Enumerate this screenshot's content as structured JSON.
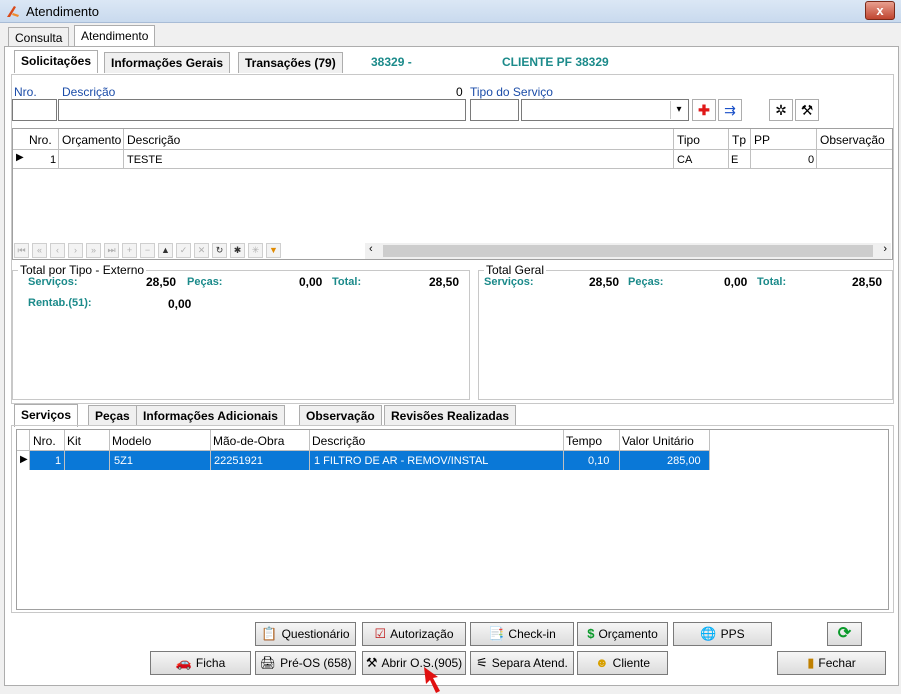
{
  "window": {
    "title": "Atendimento",
    "close_glyph": "x"
  },
  "outer_tabs": [
    {
      "label": "Consulta"
    },
    {
      "label": "Atendimento"
    }
  ],
  "inner_tabs": [
    {
      "label": "Solicitações"
    },
    {
      "label": "Informações Gerais"
    },
    {
      "label": "Transações (79)"
    }
  ],
  "header_info": {
    "code": "38329 -",
    "client": "CLIENTE PF 38329"
  },
  "form": {
    "nro_label": "Nro.",
    "descricao_label": "Descrição",
    "descricao_count": "0",
    "tipo_servico_label": "Tipo do Serviço"
  },
  "solicitacoes_grid": {
    "columns": [
      "Nro.",
      "Orçamento",
      "Descrição",
      "Tipo",
      "Tp",
      "PP",
      "Observação"
    ],
    "rows": [
      {
        "nro": "1",
        "orcamento": "",
        "descricao": "TESTE",
        "tipo": "CA",
        "tp": "E",
        "pp": "0",
        "observacao": ""
      }
    ]
  },
  "totals_externo": {
    "legend": "Total por Tipo - Externo",
    "servicos_label": "Serviços:",
    "servicos_value": "28,50",
    "pecas_label": "Peças:",
    "pecas_value": "0,00",
    "total_label": "Total:",
    "total_value": "28,50",
    "rentab_label": "Rentab.(51):",
    "rentab_value": "0,00"
  },
  "totals_geral": {
    "legend": "Total Geral",
    "servicos_label": "Serviços:",
    "servicos_value": "28,50",
    "pecas_label": "Peças:",
    "pecas_value": "0,00",
    "total_label": "Total:",
    "total_value": "28,50"
  },
  "detail_tabs": [
    {
      "label": "Serviços"
    },
    {
      "label": "Peças"
    },
    {
      "label": "Informações Adicionais"
    },
    {
      "label": "Observação"
    },
    {
      "label": "Revisões Realizadas"
    }
  ],
  "servicos_grid": {
    "columns": [
      "Nro.",
      "Kit",
      "Modelo",
      "Mão-de-Obra",
      "Descrição",
      "Tempo",
      "Valor Unitário"
    ],
    "rows": [
      {
        "nro": "1",
        "kit": "",
        "modelo": "5Z1",
        "mao_de_obra": "22251921",
        "descricao": "1 FILTRO DE AR - REMOV/INSTAL",
        "tempo": "0,10",
        "valor": "285,00"
      }
    ]
  },
  "buttons": {
    "questionario": "Questionário",
    "autorizacao": "Autorização",
    "checkin": "Check-in",
    "orcamento": "Orçamento",
    "pps": "PPS",
    "ficha": "Ficha",
    "pre_os": "Pré-OS (658)",
    "abrir_os": "Abrir O.S.(905)",
    "separa_atend": "Separa Atend.",
    "cliente": "Cliente",
    "fechar": "Fechar"
  },
  "colors": {
    "selection": "#0a78d7",
    "teal": "#1b8a8a",
    "blue_label": "#1b4ca8"
  },
  "icons": [
    "app-icon",
    "close-icon",
    "add-red-cross-icon",
    "move-items-icon",
    "tool-icon",
    "wrench-icon",
    "refresh-icon"
  ]
}
